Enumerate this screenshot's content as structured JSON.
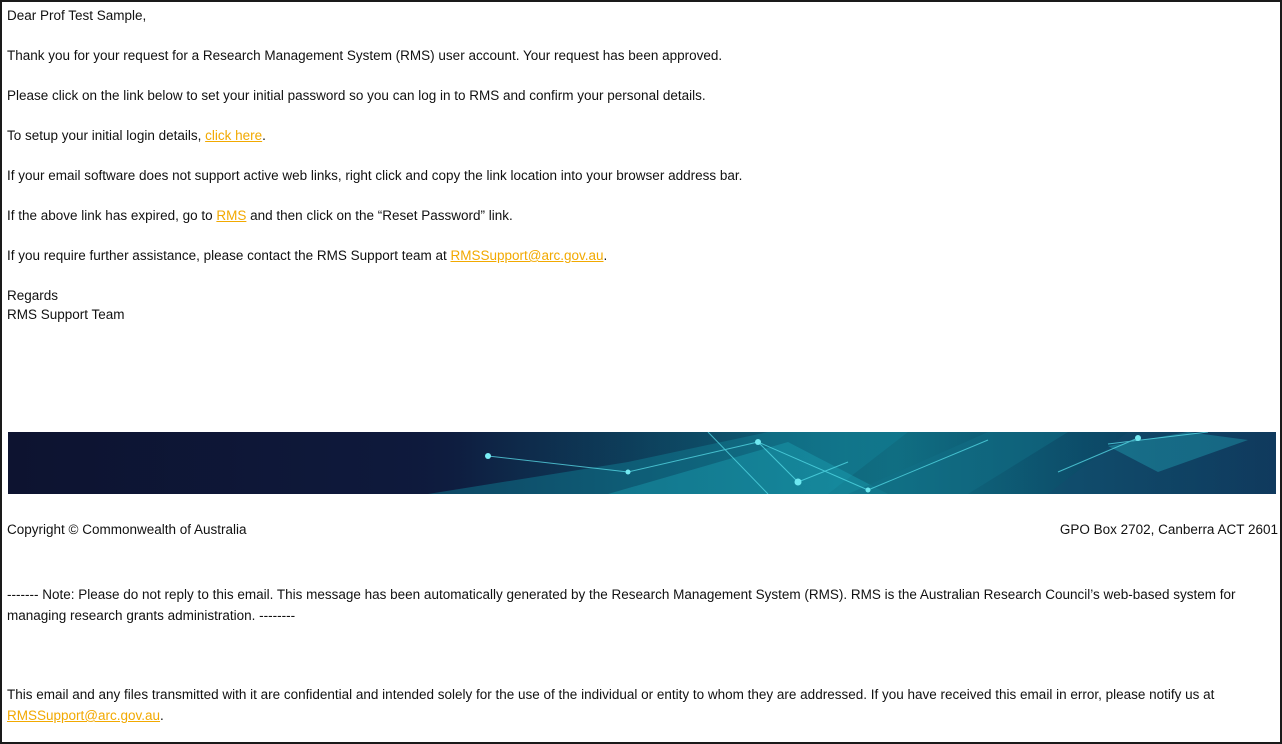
{
  "email": {
    "greeting": "Dear Prof Test Sample,",
    "para1": "Thank you for your request for a Research Management System (RMS) user account. Your request has been approved.",
    "para2": "Please click on the link below to set your initial password so you can log in to RMS and confirm your personal details.",
    "para3_prefix": "To setup your initial login details, ",
    "para3_link": "click here",
    "para3_suffix": ".",
    "para4": "If your email software does not support active web links, right click and copy the link location into your browser address bar.",
    "para5_prefix": "If the above link has expired, go to ",
    "para5_link": "RMS",
    "para5_suffix": " and then click on the “Reset Password” link.",
    "para6_prefix": "If you require further assistance, please contact the RMS Support team at ",
    "para6_link": "RMSSupport@arc.gov.au",
    "para6_suffix": ".",
    "regards": "Regards",
    "signature": "RMS Support Team"
  },
  "footer": {
    "copyright": "Copyright © Commonwealth of Australia",
    "address": "GPO Box 2702, Canberra ACT 2601",
    "note": "------- Note: Please do not reply to this email. This message has been automatically generated by the Research Management System (RMS). RMS is the Australian Research Council’s web-based system for managing research grants administration. --------",
    "confidential_prefix": "This email and any files transmitted with it are confidential and intended solely for the use of the individual or entity to whom they are addressed. If you have received this email in error, please notify us at ",
    "confidential_link": "RMSSupport@arc.gov.au",
    "confidential_suffix": "."
  },
  "colors": {
    "link": "#f2a900",
    "banner_dark": "#0d1330",
    "banner_teal": "#0b5d73"
  }
}
